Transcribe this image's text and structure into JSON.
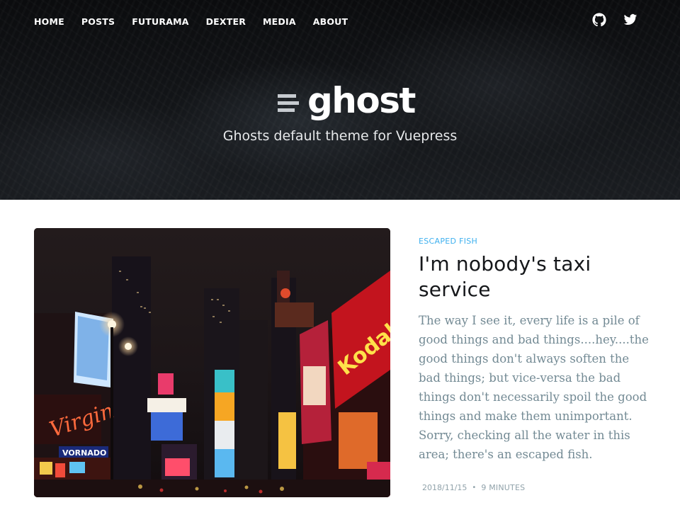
{
  "nav": {
    "items": [
      "HOME",
      "POSTS",
      "FUTURAMA",
      "DEXTER",
      "MEDIA",
      "ABOUT"
    ]
  },
  "social": {
    "icons": [
      "github-icon",
      "twitter-icon"
    ]
  },
  "hero": {
    "logo_text": "ghost",
    "tagline": "Ghosts default theme for Vuepress"
  },
  "post": {
    "tag": "ESCAPED FISH",
    "title": "I'm nobody's taxi service",
    "excerpt": "The way I see it, every life is a pile of good things and bad things....hey....the good things don't always soften the bad things; but vice-versa the bad things don't necessarily spoil the good things and make them unimportant. Sorry, checking all the water in this area; there's an escaped fish.",
    "date": "2018/11/15",
    "reading_time": "9 MINUTES",
    "image_sign_texts": [
      "Virgin",
      "VORNADO",
      "Kodak"
    ]
  },
  "colors": {
    "accent": "#3eb0ef",
    "hero_bg": "#121417",
    "excerpt": "#738a94",
    "meta": "#90a2aa"
  }
}
